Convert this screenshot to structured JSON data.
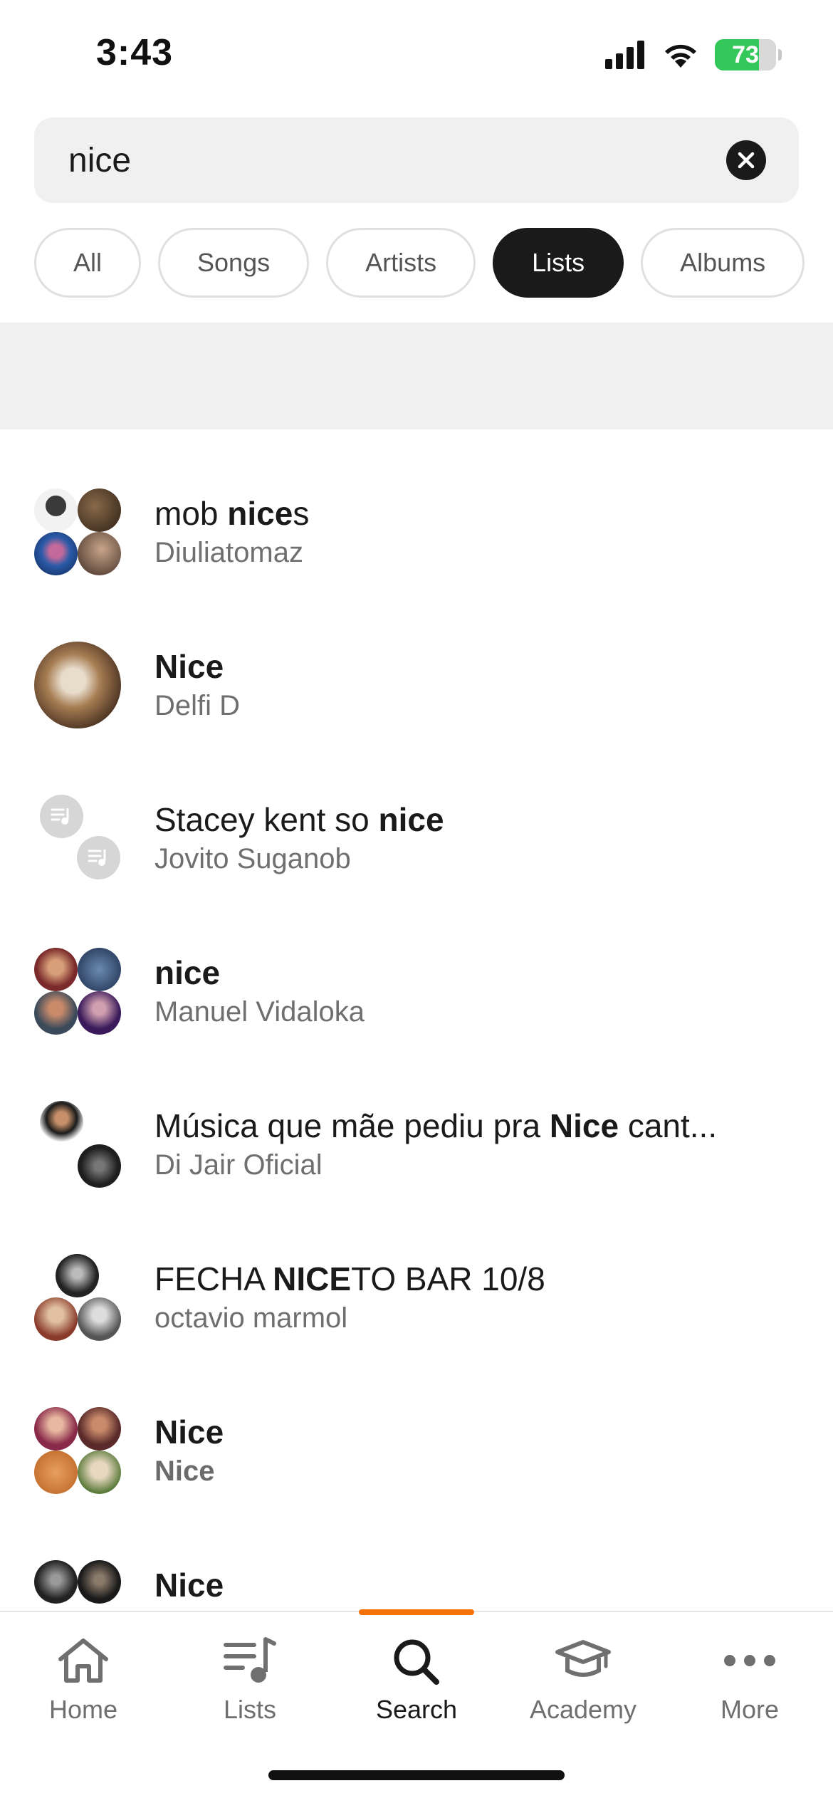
{
  "status_bar": {
    "time": "3:43",
    "battery": "73"
  },
  "search": {
    "value": "nice",
    "placeholder": ""
  },
  "filters": [
    {
      "label": "All",
      "active": false
    },
    {
      "label": "Songs",
      "active": false
    },
    {
      "label": "Artists",
      "active": false
    },
    {
      "label": "Lists",
      "active": true
    },
    {
      "label": "Albums",
      "active": false
    }
  ],
  "results": [
    {
      "title_pre": "mob ",
      "title_bold": "nice",
      "title_post": "s",
      "subtitle": "Diuliatomaz"
    },
    {
      "title_pre": "",
      "title_bold": "Nice",
      "title_post": "",
      "subtitle": "Delfi D"
    },
    {
      "title_pre": "Stacey kent so ",
      "title_bold": "nice",
      "title_post": "",
      "subtitle": "Jovito Suganob"
    },
    {
      "title_pre": "",
      "title_bold": "nice",
      "title_post": "",
      "subtitle": "Manuel Vidaloka"
    },
    {
      "title_pre": "Música que mãe pediu pra ",
      "title_bold": "Nice",
      "title_post": " cant...",
      "subtitle": "Di Jair Oficial"
    },
    {
      "title_pre": "FECHA ",
      "title_bold": "NICE",
      "title_post": "TO BAR 10/8",
      "subtitle": "octavio marmol"
    },
    {
      "title_pre": "",
      "title_bold": "Nice",
      "title_post": "",
      "subtitle": "Nice"
    },
    {
      "title_pre": "",
      "title_bold": "Nice",
      "title_post": "",
      "subtitle": ""
    }
  ],
  "tabs": [
    {
      "label": "Home",
      "icon": "home-icon"
    },
    {
      "label": "Lists",
      "icon": "playlist-icon"
    },
    {
      "label": "Search",
      "icon": "search-icon"
    },
    {
      "label": "Academy",
      "icon": "graduation-cap-icon"
    },
    {
      "label": "More",
      "icon": "more-dots-icon"
    }
  ],
  "colors": {
    "accent": "#f7730a",
    "active_chip": "#1a1a1a",
    "battery": "#34c759"
  }
}
